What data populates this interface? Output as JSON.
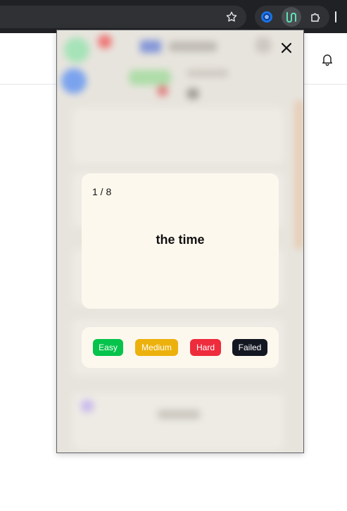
{
  "browser": {
    "icons": [
      "star-icon",
      "extension-globe-icon",
      "extension-logo-icon",
      "puzzle-icon"
    ]
  },
  "page": {
    "icons": [
      "bell-icon"
    ]
  },
  "flashcard": {
    "counter": "1 / 8",
    "term": "the time"
  },
  "rating": {
    "buttons": [
      {
        "label": "Easy",
        "color": "#05c34b"
      },
      {
        "label": "Medium",
        "color": "#ecb10d"
      },
      {
        "label": "Hard",
        "color": "#ee2c3c"
      },
      {
        "label": "Failed",
        "color": "#131722"
      }
    ]
  },
  "colors": {
    "card_background": "#fdf8ee",
    "popup_overlay": "#e7e4dd",
    "chrome_bar": "#202124"
  }
}
